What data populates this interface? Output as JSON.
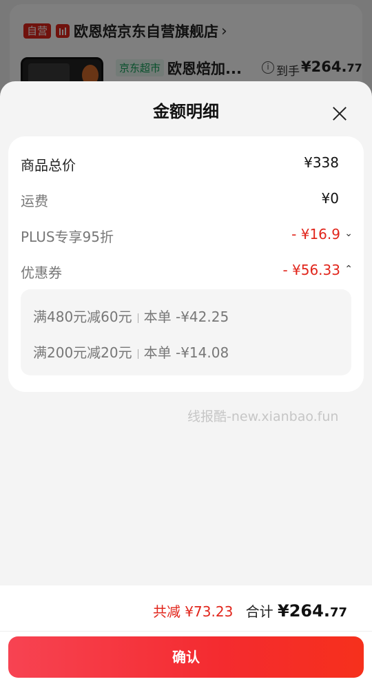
{
  "background": {
    "self_tag": "自营",
    "store_name": "欧恩焙京东自营旗舰店",
    "store_chevron": "›",
    "market_tag": "京东超市",
    "product_title": "欧恩焙加...",
    "arrive_label": "到手",
    "arrive_price_main": "¥264.",
    "arrive_price_decimal": "77"
  },
  "sheet": {
    "title": "金额明细",
    "rows": [
      {
        "label": "商品总价",
        "value": "¥338"
      },
      {
        "label": "运费",
        "value": "¥0"
      },
      {
        "label": "PLUS专享95折",
        "value": "- ¥16.9",
        "chevron": "⌄"
      },
      {
        "label": "优惠券",
        "value": "- ¥56.33",
        "chevron": "⌃"
      }
    ],
    "coupons": [
      {
        "name": "满480元减60元",
        "detail": "本单 -¥42.25"
      },
      {
        "name": "满200元减20元",
        "detail": "本单 -¥14.08"
      }
    ],
    "watermark": "线报酷-new.xianbao.fun"
  },
  "footer": {
    "saved": "共减 ¥73.23",
    "total_label": "合计",
    "total_main": "¥264.",
    "total_decimal": "77",
    "confirm": "确认"
  },
  "colors": {
    "accent_red": "#e1251b",
    "market_green": "#14a05a"
  }
}
